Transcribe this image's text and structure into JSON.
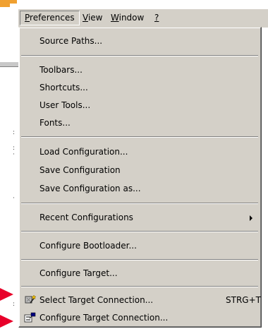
{
  "menubar": {
    "items": [
      {
        "label": "Preferences"
      },
      {
        "label": "View"
      },
      {
        "label": "Window"
      },
      {
        "label": "?"
      }
    ]
  },
  "menu": {
    "source_paths": "Source Paths...",
    "toolbars": "Toolbars...",
    "shortcuts": "Shortcuts...",
    "user_tools": "User Tools...",
    "fonts": "Fonts...",
    "load_configuration": "Load Configuration...",
    "save_configuration": "Save Configuration",
    "save_configuration_as": "Save Configuration as...",
    "recent_configurations": "Recent Configurations",
    "configure_bootloader": "Configure Bootloader...",
    "configure_target": "Configure Target...",
    "select_target_connection": "Select Target Connection...",
    "select_target_connection_shortcut": "STRG+T",
    "configure_target_connection": "Configure Target Connection..."
  },
  "colors": {
    "menu_face": "#d4d0c8",
    "annotation_arrow": "#e8002a"
  },
  "icons": {
    "select_target_connection": "connection-wand-icon",
    "configure_target_connection": "connection-settings-icon"
  }
}
